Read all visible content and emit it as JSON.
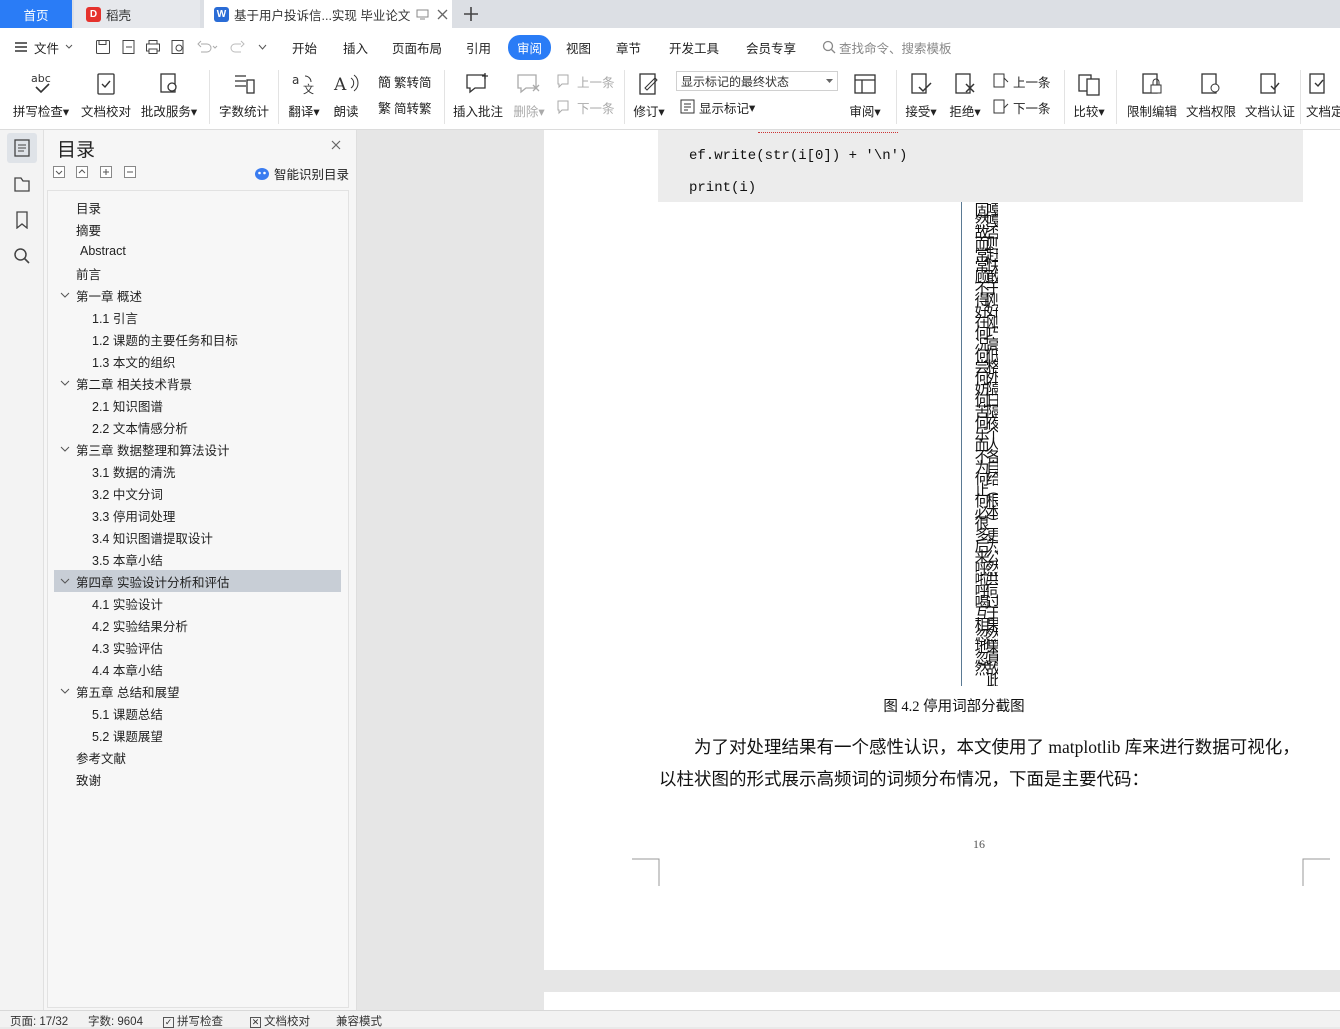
{
  "tabs": {
    "home": "首页",
    "daoke": "稻壳",
    "doc": "基于用户投诉信...实现 毕业论文"
  },
  "menu": {
    "file": "文件",
    "items": [
      "开始",
      "插入",
      "页面布局",
      "引用",
      "审阅",
      "视图",
      "章节",
      "开发工具",
      "会员专享"
    ],
    "active": "审阅",
    "search": "查找命令、搜索模板"
  },
  "ribbon": {
    "spell": "拼写检查",
    "doccheck": "文档校对",
    "batch": "批改服务",
    "wordcount": "字数统计",
    "translate": "翻译",
    "read": "朗读",
    "t2s": "繁转简",
    "s2t": "简转繁",
    "insert_comment": "插入批注",
    "delete": "删除",
    "prev": "上一条",
    "next": "下一条",
    "markup_select": "显示标记的最终状态",
    "show_markup": "显示标记",
    "revise": "修订",
    "review": "审阅",
    "accept": "接受",
    "reject": "拒绝",
    "prev2": "上一条",
    "next2": "下一条",
    "compare": "比较",
    "restrict": "限制编辑",
    "rights": "文档权限",
    "cert": "文档认证",
    "final": "文档定"
  },
  "toc": {
    "title": "目录",
    "smart": "智能识别目录",
    "items": [
      "目录",
      "摘要",
      "Abstract",
      "前言",
      "第一章 概述",
      "1.1 引言",
      "1.2  课题的主要任务和目标",
      "1.3 本文的组织",
      "第二章 相关技术背景",
      "2.1  知识图谱",
      "2.2 文本情感分析",
      "第三章 数据整理和算法设计",
      "3.1 数据的清洗",
      "3.2 中文分词",
      "3.3 停用词处理",
      "3.4 知识图谱提取设计",
      "3.5 本章小结",
      "第四章 实验设计分析和评估",
      "4.1 实验设计",
      "4.2 实验结果分析",
      "4.3 实验评估",
      "4.4 本章小结",
      "第五章 总结和展望",
      "5.1 课题总结",
      "5.2 课题展望",
      "参考文献",
      "致谢"
    ]
  },
  "doc": {
    "code_line1": "ef.write(str(i[0]) + '\\n')",
    "code_line2": "print(i)",
    "stopwords": "嘎嘎否则赶快敢于刚好刚巧高低格外隔日隔夜个人各自给（根本）更为公然共同过于果然果真故此固然故而常常顾不得好在何况何尝何妨何苦何乐而不为何止何必很多后来呼啦呼喝互相忽地忽然",
    "caption": "图 4.2     停用词部分截图",
    "para1": "为了对处理结果有一个感性认识，本文使用了 matplotlib 库来进行数据可视化，",
    "para2": "以柱状图的形式展示高频词的词频分布情况，下面是主要代码：",
    "page_no": "16"
  },
  "status": {
    "page": "页面: 17/32",
    "words": "字数: 9604",
    "spell": "拼写检查",
    "check": "文档校对",
    "compat": "兼容模式"
  }
}
